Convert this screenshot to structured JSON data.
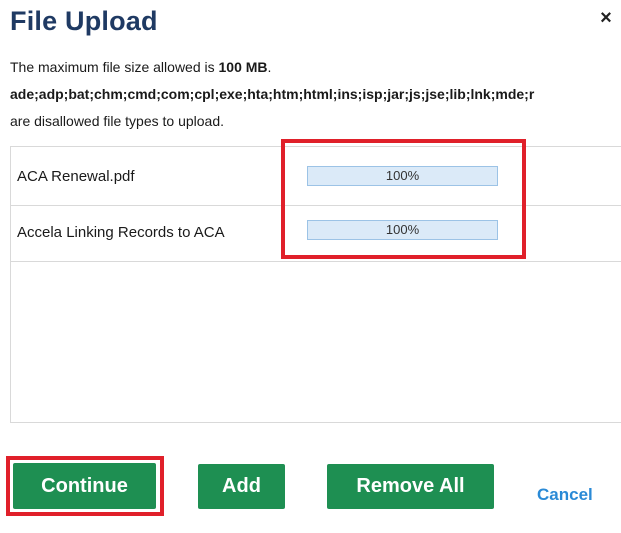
{
  "dialog": {
    "title": "File Upload",
    "close_glyph": "×",
    "info_max_prefix": "The maximum file size allowed is ",
    "info_max_value": "100 MB",
    "info_max_suffix": ".",
    "disallowed_types": "ade;adp;bat;chm;cmd;com;cpl;exe;hta;htm;html;ins;isp;jar;js;jse;lib;lnk;mde;r",
    "disallowed_note": "are disallowed file types to upload."
  },
  "files": [
    {
      "name": "ACA Renewal.pdf",
      "progress_label": "100%",
      "progress": 1.0
    },
    {
      "name": "Accela Linking Records to ACA",
      "progress_label": "100%",
      "progress": 1.0
    }
  ],
  "buttons": {
    "continue": "Continue",
    "add": "Add",
    "remove_all": "Remove All",
    "cancel": "Cancel"
  },
  "colors": {
    "title": "#1f3a63",
    "button_green": "#1e8f52",
    "cancel_link": "#2a8ad6",
    "highlight_red": "#e0202a",
    "progress_fill": "#dbeaf8"
  }
}
